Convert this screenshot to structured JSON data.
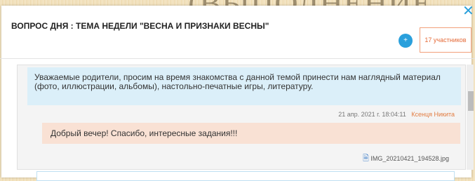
{
  "background_title": "(ВЫПОЛНЕНИЕ",
  "dialog": {
    "title": "ВОПРОС ДНЯ : ТЕМА НЕДЕЛИ \"ВЕСНА И ПРИЗНАКИ ВЕСНЫ\"",
    "close_label": "✕",
    "participants_label": "17 участников",
    "add_icon": "+"
  },
  "messages": [
    {
      "text": "Уважаемые родители, просим на время знакомства с данной темой принести нам наглядный материал (фото, иллюстрации, альбомы), настольно-печатные игры, литературу.",
      "timestamp": "21 апр. 2021 г. 18:04:11",
      "author": "Ксенця Никита"
    },
    {
      "text": "Добрый вечер! Спасибо, интересные задания!!!",
      "attachment": "IMG_20210421_194528.jpg"
    }
  ],
  "colors": {
    "accent": "#2aa0dc",
    "author": "#e27d42",
    "incoming_bubble": "#dbeff9",
    "reply_bubble": "#f9e1d4"
  }
}
